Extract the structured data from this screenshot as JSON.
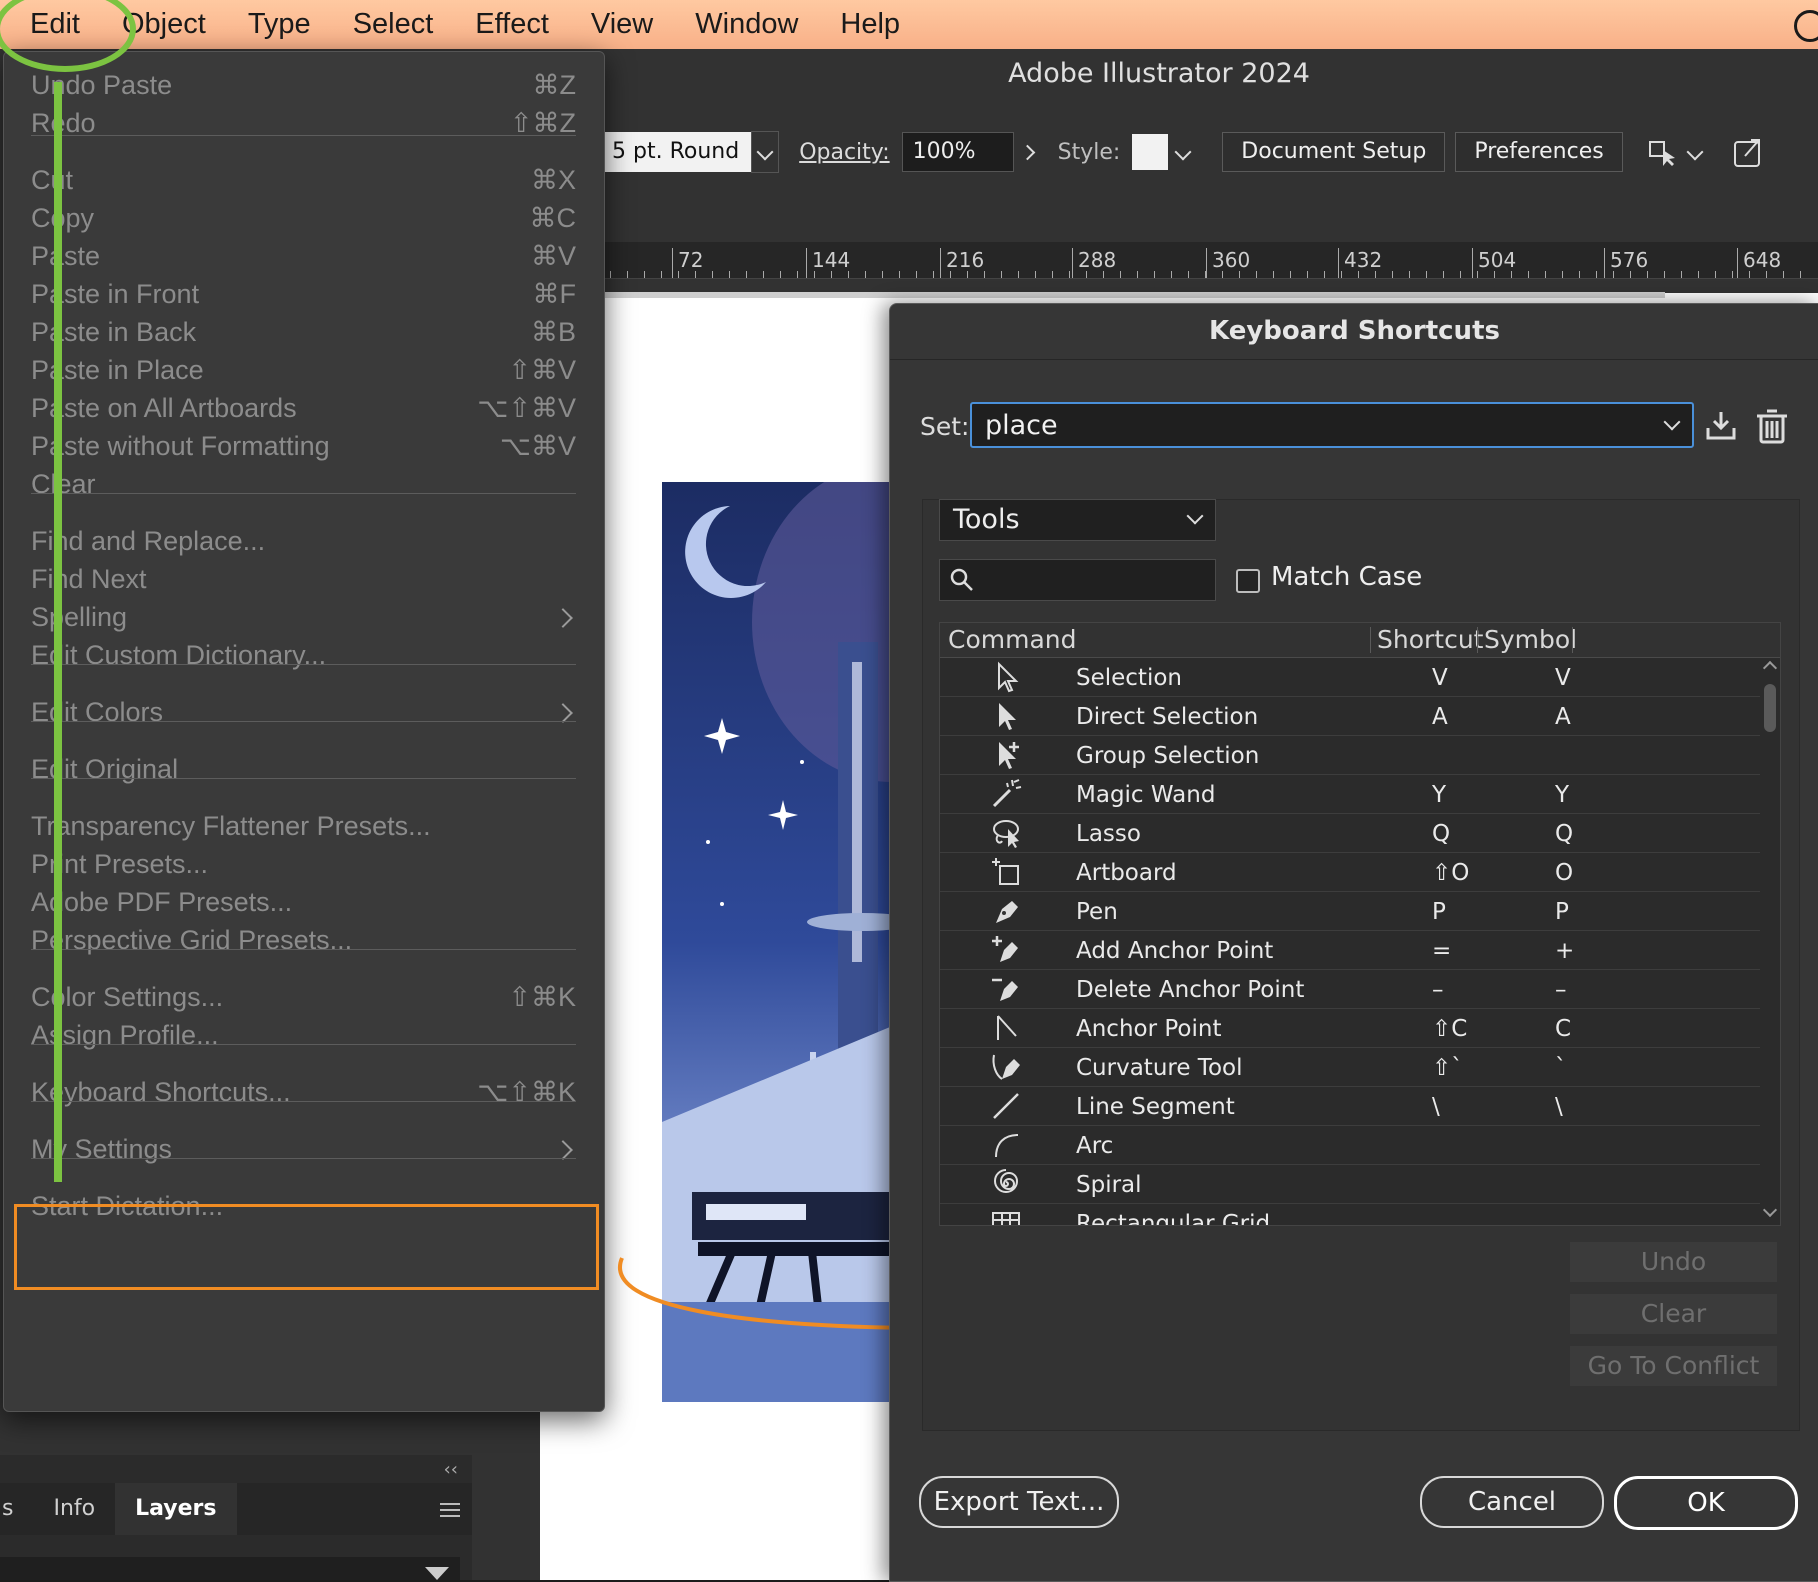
{
  "menubar": {
    "items": [
      "Edit",
      "Object",
      "Type",
      "Select",
      "Effect",
      "View",
      "Window",
      "Help"
    ]
  },
  "app": {
    "title": "Adobe Illustrator 2024"
  },
  "controlbar": {
    "stroke_profile": "5 pt. Round",
    "opacity_label": "Opacity:",
    "opacity_value": "100%",
    "style_label": "Style:",
    "document_setup": "Document Setup",
    "preferences": "Preferences"
  },
  "ruler": {
    "labels": [
      "72",
      "144",
      "216",
      "288",
      "360",
      "432",
      "504",
      "576",
      "648"
    ]
  },
  "edit_menu": {
    "items": [
      {
        "label": "Undo Paste",
        "shortcut": "⌘Z"
      },
      {
        "label": "Redo",
        "shortcut": "⇧⌘Z"
      },
      {
        "label": "Cut",
        "shortcut": "⌘X"
      },
      {
        "label": "Copy",
        "shortcut": "⌘C"
      },
      {
        "label": "Paste",
        "shortcut": "⌘V"
      },
      {
        "label": "Paste in Front",
        "shortcut": "⌘F"
      },
      {
        "label": "Paste in Back",
        "shortcut": "⌘B"
      },
      {
        "label": "Paste in Place",
        "shortcut": "⇧⌘V"
      },
      {
        "label": "Paste on All Artboards",
        "shortcut": "⌥⇧⌘V"
      },
      {
        "label": "Paste without Formatting",
        "shortcut": "⌥⌘V"
      },
      {
        "label": "Clear",
        "shortcut": ""
      },
      {
        "label": "Find and Replace...",
        "shortcut": ""
      },
      {
        "label": "Find Next",
        "shortcut": ""
      },
      {
        "label": "Spelling",
        "shortcut": ""
      },
      {
        "label": "Edit Custom Dictionary...",
        "shortcut": ""
      },
      {
        "label": "Edit Colors",
        "shortcut": ""
      },
      {
        "label": "Edit Original",
        "shortcut": ""
      },
      {
        "label": "Transparency Flattener Presets...",
        "shortcut": ""
      },
      {
        "label": "Print Presets...",
        "shortcut": ""
      },
      {
        "label": "Adobe PDF Presets...",
        "shortcut": ""
      },
      {
        "label": "Perspective Grid Presets...",
        "shortcut": ""
      },
      {
        "label": "Color Settings...",
        "shortcut": "⇧⌘K"
      },
      {
        "label": "Assign Profile...",
        "shortcut": ""
      },
      {
        "label": "Keyboard Shortcuts...",
        "shortcut": "⌥⇧⌘K"
      },
      {
        "label": "My Settings",
        "shortcut": ""
      },
      {
        "label": "Start Dictation...",
        "shortcut": ""
      }
    ]
  },
  "layers_panel": {
    "tabs": [
      "s",
      "Info",
      "Layers"
    ],
    "collapse": "‹‹"
  },
  "keyboard_shortcuts": {
    "title": "Keyboard Shortcuts",
    "set_label": "Set:",
    "set_value": "place",
    "category": "Tools",
    "search_placeholder": "",
    "match_case": "Match Case",
    "columns": [
      "Command",
      "Shortcut",
      "Symbol"
    ],
    "rows": [
      {
        "icon": "selection-tool-icon",
        "command": "Selection",
        "shortcut": "V",
        "symbol": "V"
      },
      {
        "icon": "direct-selection-tool-icon",
        "command": "Direct Selection",
        "shortcut": "A",
        "symbol": "A"
      },
      {
        "icon": "group-selection-tool-icon",
        "command": "Group Selection",
        "shortcut": "",
        "symbol": ""
      },
      {
        "icon": "magic-wand-tool-icon",
        "command": "Magic Wand",
        "shortcut": "Y",
        "symbol": "Y"
      },
      {
        "icon": "lasso-tool-icon",
        "command": "Lasso",
        "shortcut": "Q",
        "symbol": "Q"
      },
      {
        "icon": "artboard-tool-icon",
        "command": "Artboard",
        "shortcut": "⇧O",
        "symbol": "O"
      },
      {
        "icon": "pen-tool-icon",
        "command": "Pen",
        "shortcut": "P",
        "symbol": "P"
      },
      {
        "icon": "add-anchor-point-tool-icon",
        "command": "Add Anchor Point",
        "shortcut": "=",
        "symbol": "+"
      },
      {
        "icon": "delete-anchor-point-tool-icon",
        "command": "Delete Anchor Point",
        "shortcut": "–",
        "symbol": "–"
      },
      {
        "icon": "anchor-point-tool-icon",
        "command": "Anchor Point",
        "shortcut": "⇧C",
        "symbol": "C"
      },
      {
        "icon": "curvature-tool-icon",
        "command": "Curvature Tool",
        "shortcut": "⇧`",
        "symbol": "`"
      },
      {
        "icon": "line-segment-tool-icon",
        "command": "Line Segment",
        "shortcut": "\\",
        "symbol": "\\"
      },
      {
        "icon": "arc-tool-icon",
        "command": "Arc",
        "shortcut": "",
        "symbol": ""
      },
      {
        "icon": "spiral-tool-icon",
        "command": "Spiral",
        "shortcut": "",
        "symbol": ""
      },
      {
        "icon": "rectangular-grid-tool-icon",
        "command": "Rectangular Grid",
        "shortcut": "",
        "symbol": ""
      }
    ],
    "undo": "Undo",
    "clear": "Clear",
    "go_to_conflict": "Go To Conflict",
    "export_text": "Export Text...",
    "cancel": "Cancel",
    "ok": "OK"
  },
  "colors": {
    "menubar": "#f8b088",
    "annotation_green": "#7cc341",
    "annotation_orange": "#f08c23",
    "focus_blue": "#4a90d9"
  }
}
